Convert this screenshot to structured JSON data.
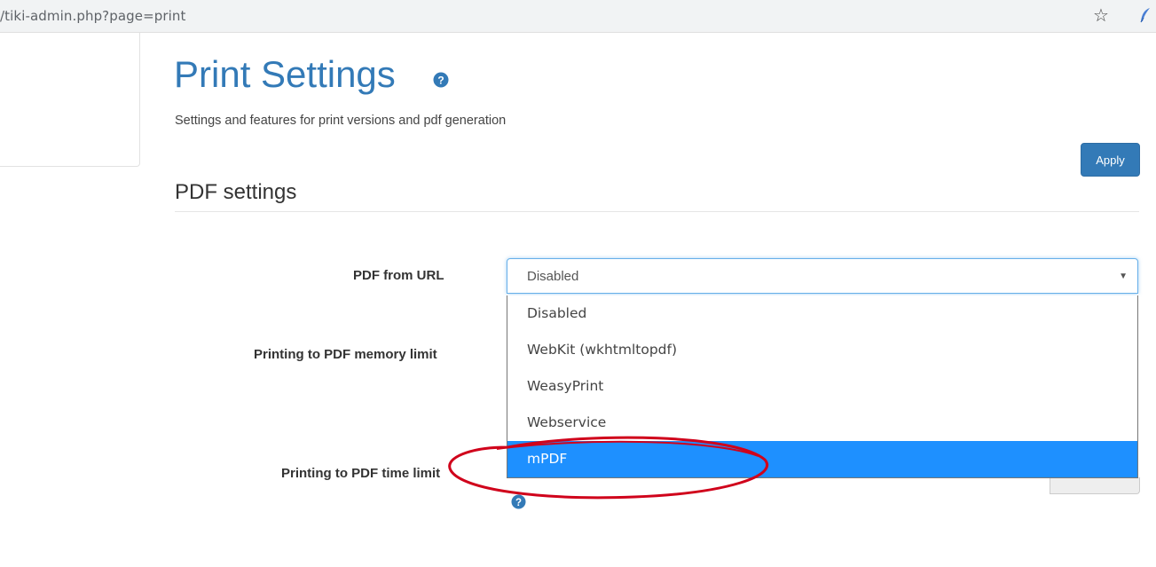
{
  "browser": {
    "url": "/tiki-admin.php?page=print",
    "star_glyph": "☆"
  },
  "page": {
    "title": "Print Settings",
    "subtitle": "Settings and features for print versions and pdf generation",
    "apply_label": "Apply"
  },
  "section": {
    "title": "PDF settings"
  },
  "form": {
    "pdf_from_url_label": "PDF from URL",
    "pdf_from_url_value": "Disabled",
    "memory_limit_label": "Printing to PDF memory limit",
    "time_limit_label": "Printing to PDF time limit",
    "options": [
      "Disabled",
      "WebKit (wkhtmltopdf)",
      "WeasyPrint",
      "Webservice",
      "mPDF"
    ],
    "highlighted_option": "mPDF"
  },
  "colors": {
    "brand": "#337ab7",
    "highlight": "#1e90ff",
    "annotation": "#d0021b"
  },
  "icons": {
    "help": "question-circle-icon",
    "caret": "caret-down-icon",
    "bookmark": "star-icon",
    "extension": "feather-icon"
  }
}
